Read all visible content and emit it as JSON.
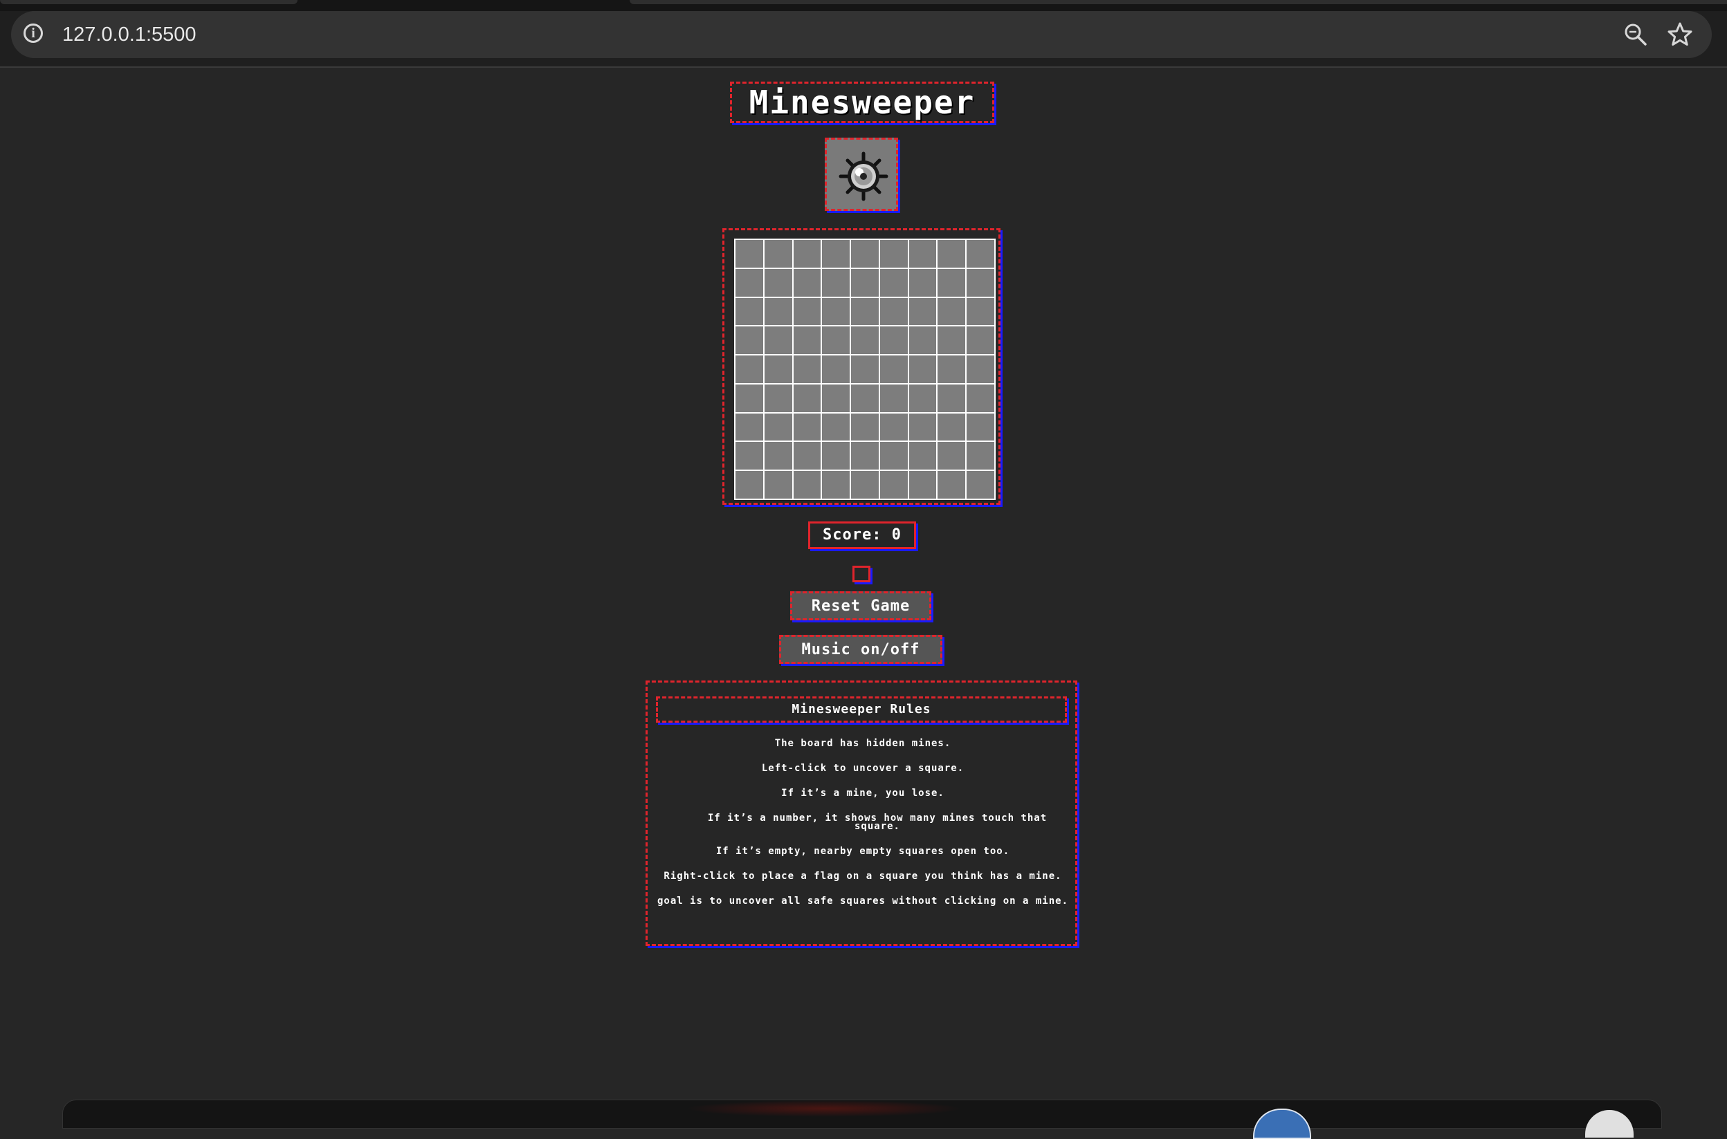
{
  "browser": {
    "url": "127.0.0.1:5500",
    "icons": [
      "info-icon",
      "zoom-icon",
      "bookmark-star-icon"
    ]
  },
  "game": {
    "title": "Minesweeper",
    "face_icon": "mine-icon",
    "board": {
      "rows": 9,
      "cols": 9
    },
    "score_text": "Score: 0",
    "reset_label": "Reset Game",
    "music_label": "Music on/off"
  },
  "rules": {
    "title": "Minesweeper Rules",
    "items": [
      "The board has hidden mines.",
      "Left-click to uncover a square.",
      "If it’s a mine, you lose.",
      "If it’s a number, it shows how many mines touch that square.",
      "If it’s empty, nearby empty squares open too.",
      "Right-click to place a flag on a square you think has a mine.",
      "goal is to uncover all safe squares without clicking on a mine."
    ]
  },
  "colors": {
    "background": "#262626",
    "border_red": "#e0242c",
    "border_blue": "#1a1aff",
    "cell_gray": "#7d7d7d"
  }
}
